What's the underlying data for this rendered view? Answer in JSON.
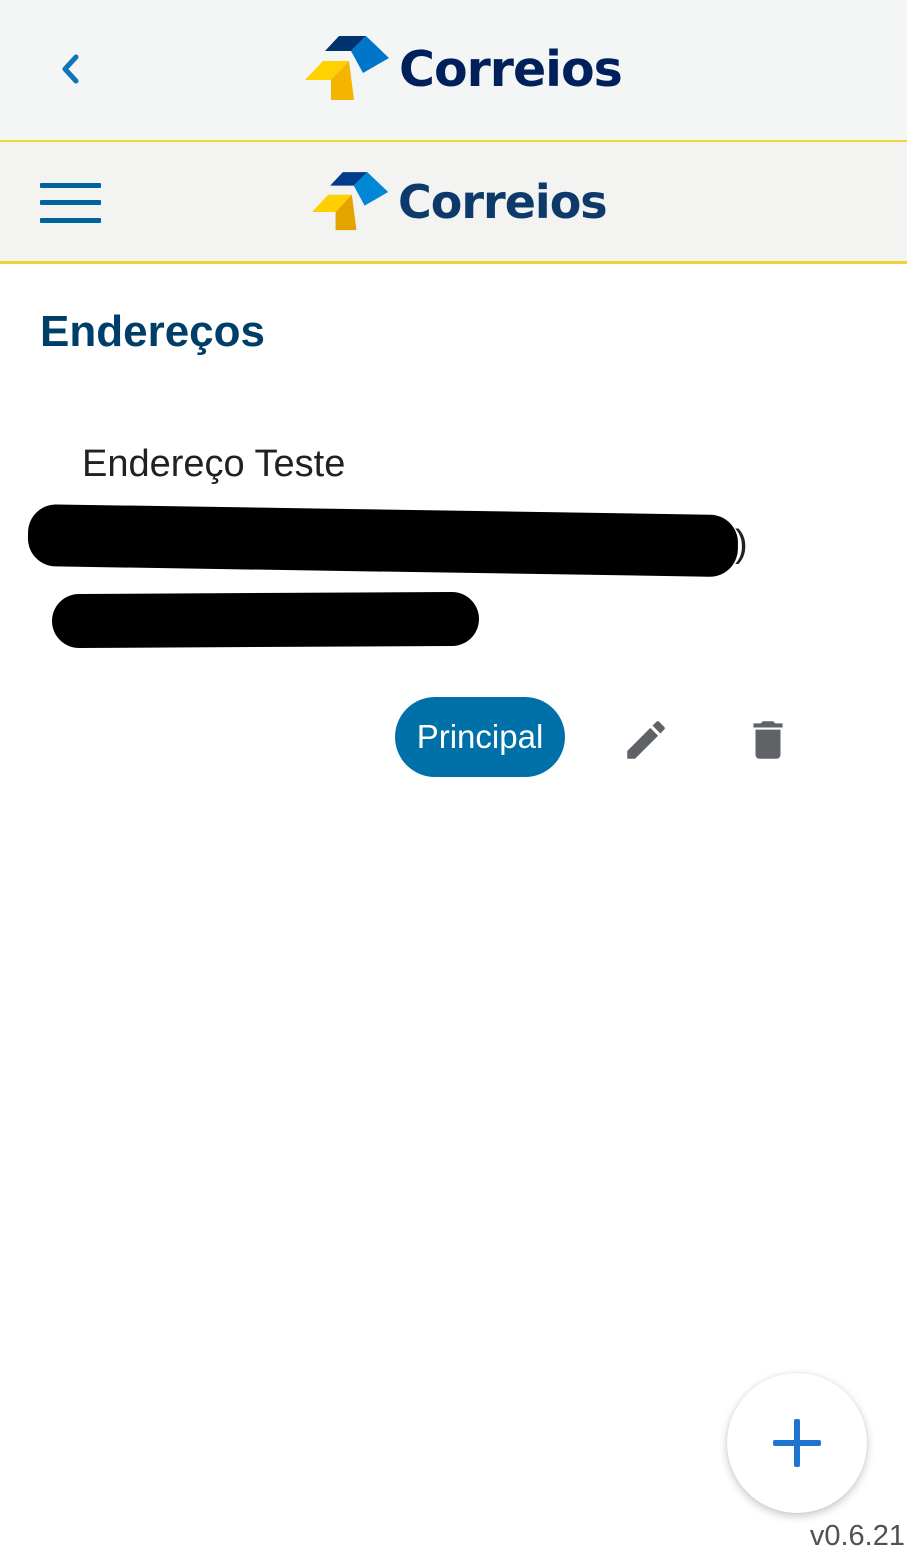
{
  "header": {
    "logo_text": "Correios"
  },
  "nav": {
    "logo_text": "Correios"
  },
  "page": {
    "title": "Endereços"
  },
  "address": {
    "name": "Endereço Teste",
    "line1_visible_end": ")",
    "principal_label": "Principal"
  },
  "icons": {
    "back": "chevron-left-icon",
    "menu": "hamburger-menu-icon",
    "edit": "pencil-icon",
    "delete": "trash-icon",
    "add": "plus-icon"
  },
  "colors": {
    "primary_blue": "#0070a8",
    "title_navy": "#003e6a",
    "accent_yellow": "#f3d031",
    "fab_plus": "#1f74d0"
  },
  "footer": {
    "version": "v0.6.21"
  }
}
